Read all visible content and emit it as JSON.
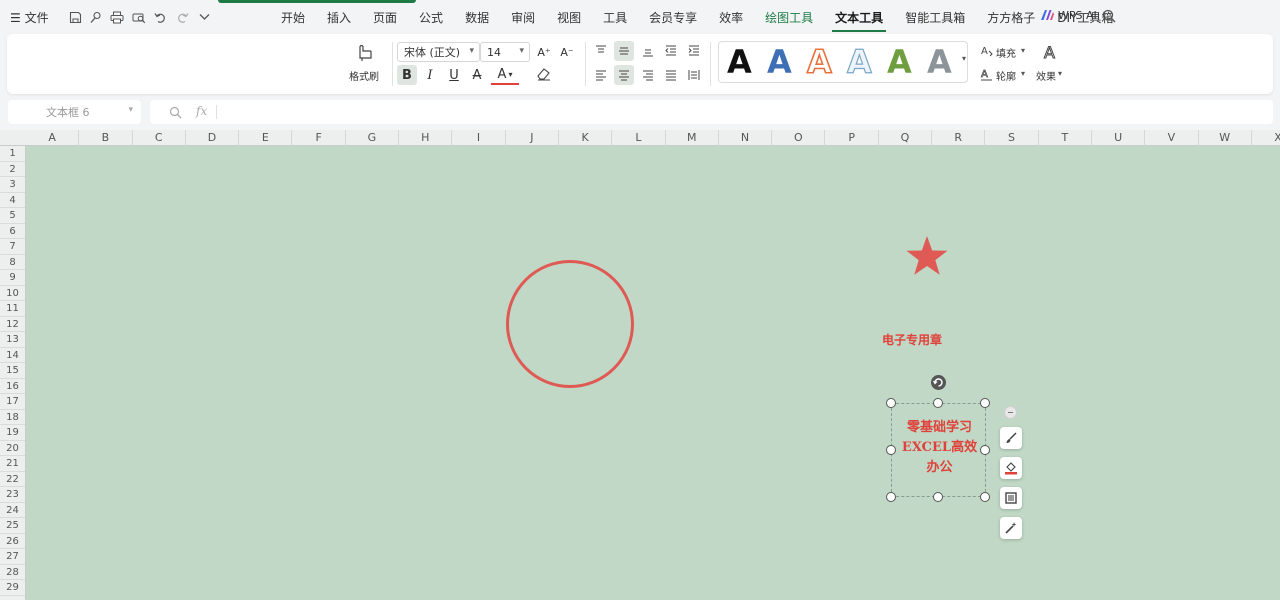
{
  "menubar": {
    "file_label": "文件",
    "tabs": [
      {
        "label": "开始"
      },
      {
        "label": "插入"
      },
      {
        "label": "页面"
      },
      {
        "label": "公式"
      },
      {
        "label": "数据"
      },
      {
        "label": "审阅"
      },
      {
        "label": "视图"
      },
      {
        "label": "工具"
      },
      {
        "label": "会员专享"
      },
      {
        "label": "效率"
      },
      {
        "label": "绘图工具"
      },
      {
        "label": "文本工具"
      },
      {
        "label": "智能工具箱"
      },
      {
        "label": "方方格子"
      },
      {
        "label": "DIY工具箱"
      }
    ],
    "active_tab": "文本工具",
    "wps_ai_label": "WPS AI",
    "quick_access_icons": [
      "save-icon",
      "format-painter-icon",
      "print-icon",
      "print-preview-icon",
      "undo-icon",
      "redo-icon",
      "more-icon"
    ]
  },
  "ribbon": {
    "format_painter_label": "格式刷",
    "font_name": "宋体 (正文)",
    "font_size": "14",
    "grow_font": "A⁺",
    "shrink_font": "A⁻",
    "bold": "B",
    "italic": "I",
    "underline": "U",
    "strikethrough": "A",
    "font_color": "A",
    "fill_label": "填充",
    "outline_label": "轮廓",
    "effects_label": "效果",
    "gallery_letter": "A"
  },
  "namebox": {
    "value": "文本框 6",
    "fx_label": "fx"
  },
  "columns": [
    "A",
    "B",
    "C",
    "D",
    "E",
    "F",
    "G",
    "H",
    "I",
    "J",
    "K",
    "L",
    "M",
    "N",
    "O",
    "P",
    "Q",
    "R",
    "S",
    "T",
    "U",
    "V",
    "W",
    "X"
  ],
  "rows": [
    "1",
    "2",
    "3",
    "4",
    "5",
    "6",
    "7",
    "8",
    "9",
    "10",
    "11",
    "12",
    "13",
    "14",
    "15",
    "16",
    "17",
    "18",
    "19",
    "20",
    "21",
    "22",
    "23",
    "24",
    "25",
    "26",
    "27",
    "28",
    "29"
  ],
  "canvas": {
    "stamp_label": "电子专用章",
    "textbox_lines": [
      "零基础学习",
      "EXCEL高效",
      "办公"
    ]
  },
  "colors": {
    "accent": "#1e7b46",
    "sheet_bg": "#c0d8c5",
    "stamp_red": "#e05a55"
  }
}
